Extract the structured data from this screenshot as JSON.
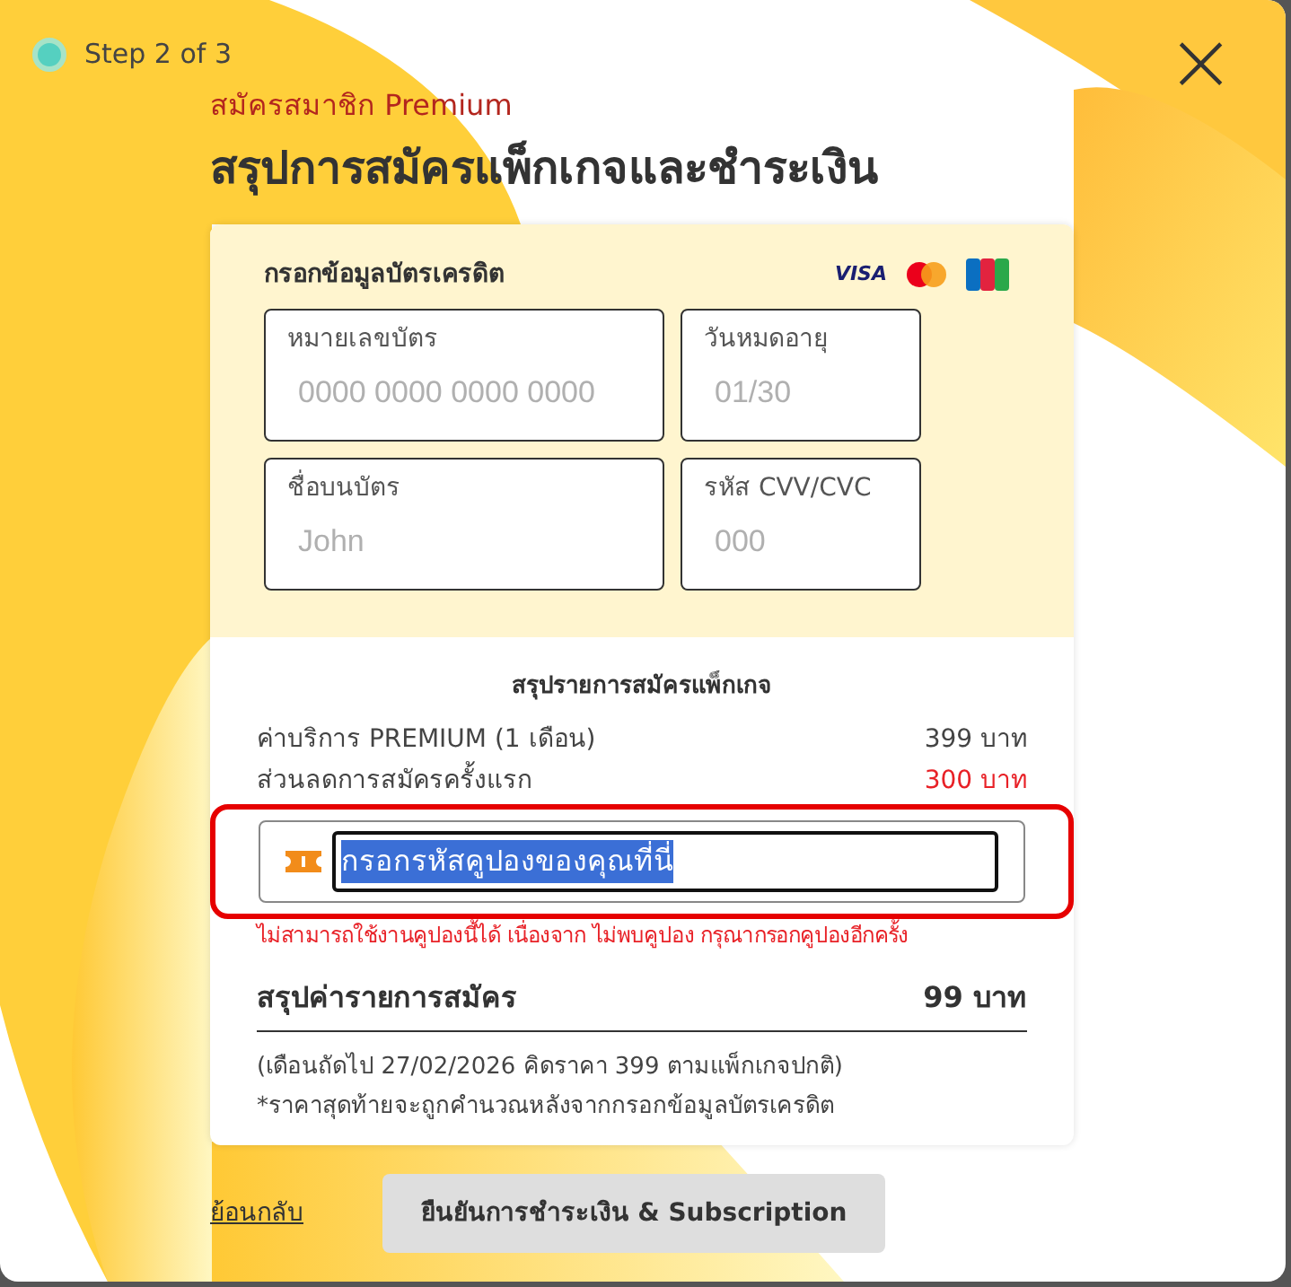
{
  "step": {
    "label": "Step 2 of 3"
  },
  "close_label": "×",
  "subtitle": "สมัครสมาชิก Premium",
  "title": "สรุปการสมัครแพ็กเกจและชำระเงิน",
  "card_form": {
    "heading": "กรอกข้อมูลบัตรเครดิต",
    "brands": [
      "VISA"
    ],
    "fields": [
      {
        "label": "หมายเลขบัตร",
        "placeholder": "0000 0000 0000 0000"
      },
      {
        "label": "วันหมดอายุ",
        "placeholder": "01/30"
      },
      {
        "label": "ชื่อบนบัตร",
        "placeholder": "John"
      },
      {
        "label": "รหัส CVV/CVC",
        "placeholder": "000"
      }
    ]
  },
  "summary": {
    "heading": "สรุปรายการสมัครแพ็กเกจ",
    "lines": [
      {
        "label": "ค่าบริการ PREMIUM (1 เดือน)",
        "amount": "399 บาท",
        "discount": false
      },
      {
        "label": "ส่วนลดการสมัครครั้งแรก",
        "amount": "300 บาท",
        "discount": true
      }
    ],
    "coupon": {
      "value": "กรอกรหัสคูปองของคุณที่นี่",
      "selected": true,
      "highlighted": true
    },
    "error": "ไม่สามารถใช้งานคูปองนี้ได้ เนื่องจาก ไม่พบคูปอง กรุณากรอกคูปองอีกครั้ง",
    "total_label": "สรุปค่ารายการสมัคร",
    "total_amount": "99 บาท",
    "notes": [
      "(เดือนถัดไป 27/02/2026 คิดราคา 399 ตามแพ็กเกจปกติ)",
      "*ราคาสุดท้ายจะถูกคำนวณหลังจากกรอกข้อมูลบัตรเครดิต"
    ]
  },
  "back_link": "ย้อนกลับ",
  "confirm_button": {
    "label": "ยืนยันการชำระเงิน & Subscription",
    "disabled": true
  }
}
